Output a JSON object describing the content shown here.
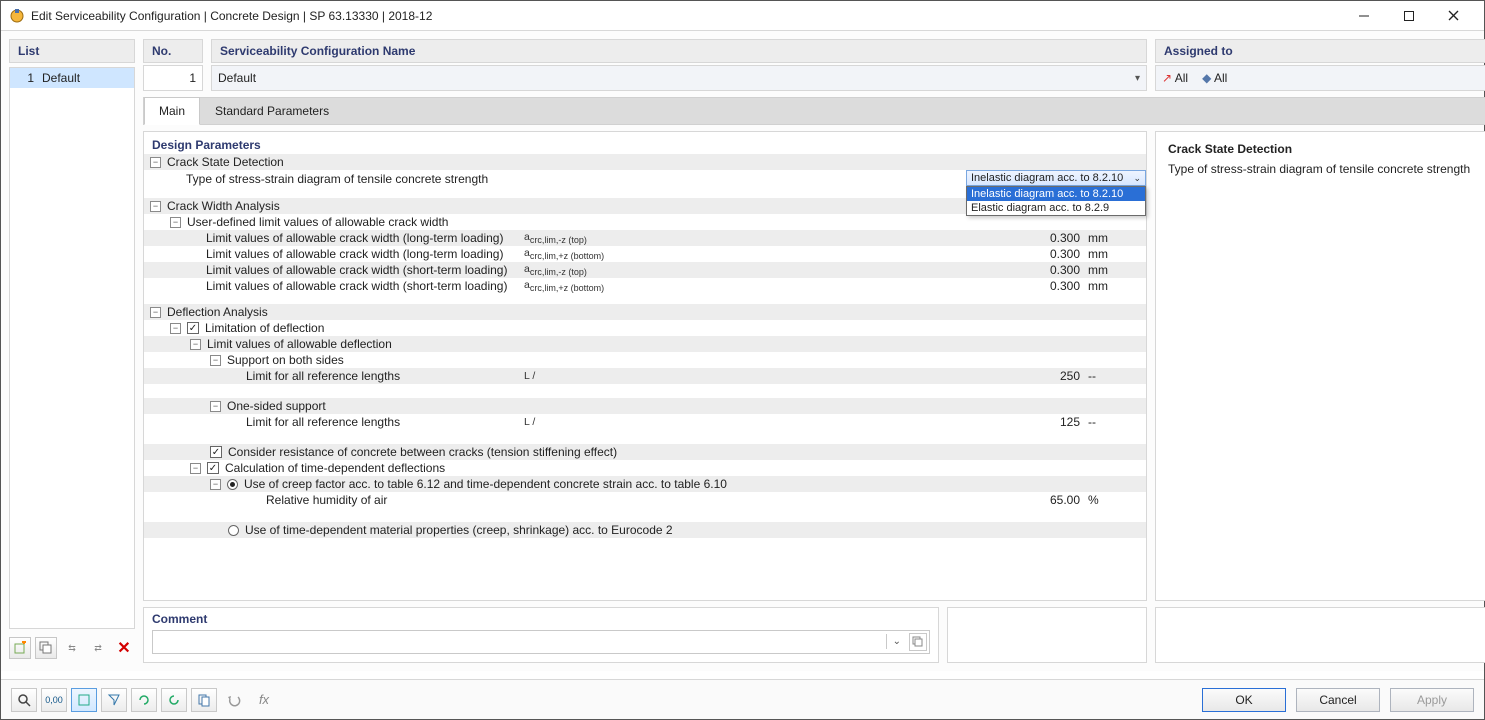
{
  "window": {
    "title": "Edit Serviceability Configuration | Concrete Design | SP 63.13330 | 2018-12"
  },
  "left": {
    "header": "List",
    "items": [
      {
        "index": "1",
        "label": "Default"
      }
    ]
  },
  "header_fields": {
    "no_label": "No.",
    "no_value": "1",
    "name_label": "Serviceability Configuration Name",
    "name_value": "Default",
    "assigned_label": "Assigned to",
    "assigned_all_1": "All",
    "assigned_all_2": "All"
  },
  "tabs": {
    "main": "Main",
    "standard": "Standard Parameters"
  },
  "params": {
    "section": "Design Parameters",
    "crack_state": {
      "title": "Crack State Detection",
      "type_label": "Type of stress-strain diagram of tensile concrete strength",
      "selected": "Inelastic diagram acc. to 8.2.10",
      "options": [
        "Inelastic diagram acc. to 8.2.10",
        "Elastic diagram acc. to 8.2.9"
      ]
    },
    "crack_width": {
      "title": "Crack Width Analysis",
      "userdef": "User-defined limit values of allowable crack width",
      "rows": [
        {
          "label": "Limit values of allowable crack width (long-term loading)",
          "sym": "a<sub>crc,lim,-z (top)</sub>",
          "val": "0.300",
          "unit": "mm"
        },
        {
          "label": "Limit values of allowable crack width (long-term loading)",
          "sym": "a<sub>crc,lim,+z (bottom)</sub>",
          "val": "0.300",
          "unit": "mm"
        },
        {
          "label": "Limit values of allowable crack width (short-term loading)",
          "sym": "a<sub>crc,lim,-z (top)</sub>",
          "val": "0.300",
          "unit": "mm"
        },
        {
          "label": "Limit values of allowable crack width (short-term loading)",
          "sym": "a<sub>crc,lim,+z (bottom)</sub>",
          "val": "0.300",
          "unit": "mm"
        }
      ]
    },
    "deflection": {
      "title": "Deflection Analysis",
      "limitation": "Limitation of deflection",
      "limit_values": "Limit values of allowable deflection",
      "support_both": "Support on both sides",
      "limit_all_both": {
        "label": "Limit for all reference lengths",
        "sym": "L /",
        "val": "250",
        "unit": "--"
      },
      "support_one": "One-sided support",
      "limit_all_one": {
        "label": "Limit for all reference lengths",
        "sym": "L /",
        "val": "125",
        "unit": "--"
      },
      "tension_stiff": "Consider resistance of concrete between cracks (tension stiffening effect)",
      "calc_td": "Calculation of time-dependent deflections",
      "opt_creep": "Use of creep factor acc. to table 6.12 and time-dependent concrete strain acc. to table 6.10",
      "rh": {
        "label": "Relative humidity of air",
        "val": "65.00",
        "unit": "%"
      },
      "opt_ec2": "Use of time-dependent material properties (creep, shrinkage) acc. to Eurocode 2"
    }
  },
  "info": {
    "title": "Crack State Detection",
    "text": "Type of stress-strain diagram of tensile concrete strength"
  },
  "comment": {
    "label": "Comment",
    "value": ""
  },
  "buttons": {
    "ok": "OK",
    "cancel": "Cancel",
    "apply": "Apply"
  }
}
